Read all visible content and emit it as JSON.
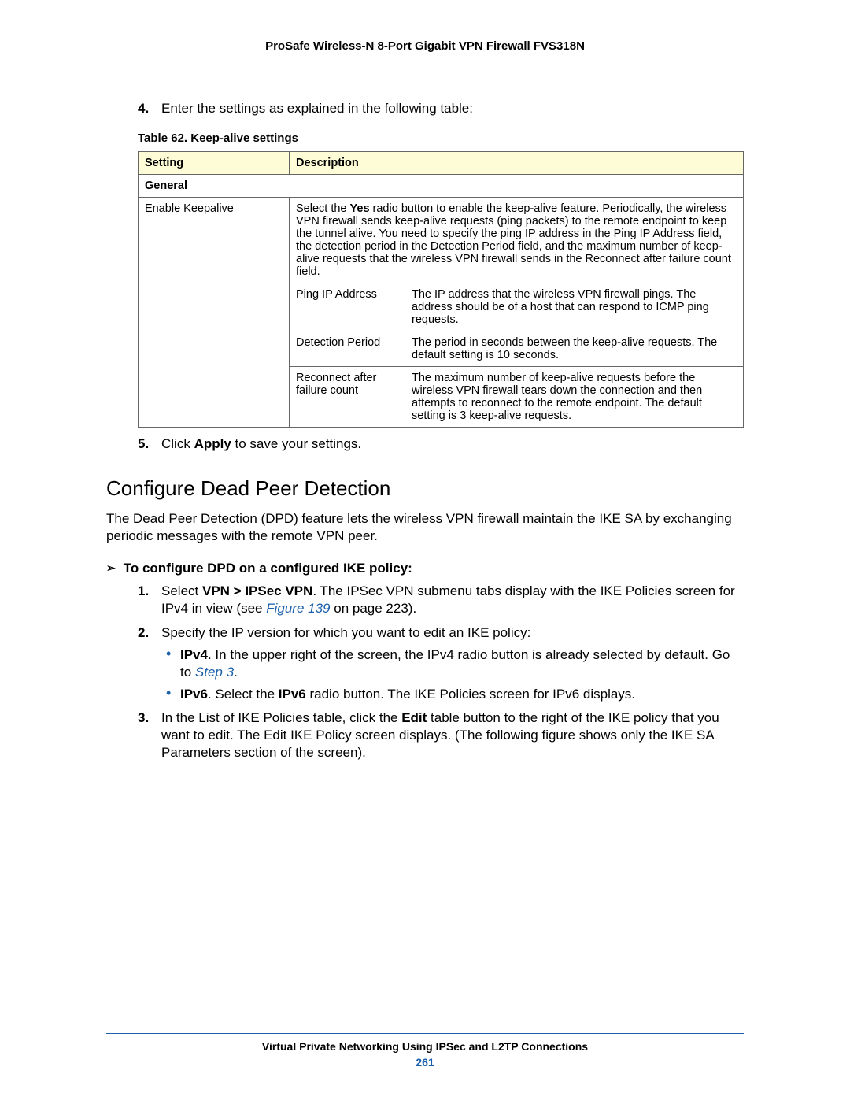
{
  "header": {
    "title": "ProSafe Wireless-N 8-Port Gigabit VPN Firewall FVS318N"
  },
  "step4": {
    "num": "4.",
    "text": "Enter the settings as explained in the following table:"
  },
  "table": {
    "caption": "Table 62.  Keep-alive settings",
    "col1": "Setting",
    "col2": "Description",
    "section": "General",
    "row1_setting": "Enable Keepalive",
    "row1_desc_a": "Select the ",
    "row1_desc_yes": "Yes",
    "row1_desc_b": " radio button to enable the keep-alive feature. Periodically, the wireless VPN firewall sends keep-alive requests (ping packets) to the remote endpoint to keep the tunnel alive. You need to specify the ping IP address in the Ping IP Address field, the detection period in the Detection Period field, and the maximum number of keep-alive requests that the wireless VPN firewall sends in the Reconnect after failure count field.",
    "sub1_label": "Ping IP Address",
    "sub1_desc": "The IP address that the wireless VPN firewall pings. The address should be of a host that can respond to ICMP ping requests.",
    "sub2_label": "Detection Period",
    "sub2_desc": "The period in seconds between the keep-alive requests. The default setting is 10 seconds.",
    "sub3_label": "Reconnect after failure count",
    "sub3_desc": "The maximum number of keep-alive requests before the wireless VPN firewall tears down the connection and then attempts to reconnect to the remote endpoint. The default setting is 3 keep-alive requests."
  },
  "step5": {
    "num": "5.",
    "a": "Click ",
    "apply": "Apply",
    "b": " to save your settings."
  },
  "heading": "Configure Dead Peer Detection",
  "intro": "The Dead Peer Detection (DPD) feature lets the wireless VPN firewall maintain the IKE SA by exchanging periodic messages with the remote VPN peer.",
  "proc": {
    "arrow": "➢",
    "title": "To configure DPD on a configured IKE policy:",
    "s1": {
      "num": "1.",
      "a": "Select ",
      "path": "VPN > IPSec VPN",
      "b": ". The IPSec VPN submenu tabs display with the IKE Policies screen for IPv4 in view (see ",
      "link": "Figure 139",
      "c": " on page 223)."
    },
    "s2": {
      "num": "2.",
      "text": "Specify the IP version for which you want to edit an IKE policy:",
      "b1a": "IPv4",
      "b1b": ". In the upper right of the screen, the IPv4 radio button is already selected by default. Go to ",
      "b1link": "Step 3",
      "b1c": ".",
      "b2a": "IPv6",
      "b2b": ". Select the ",
      "b2c": "IPv6",
      "b2d": " radio button. The IKE Policies screen for IPv6 displays."
    },
    "s3": {
      "num": "3.",
      "a": "In the List of IKE Policies table, click the ",
      "edit": "Edit",
      "b": " table button to the right of the IKE policy that you want to edit. The Edit IKE Policy screen displays. (The following figure shows only the IKE SA Parameters section of the screen)."
    }
  },
  "footer": {
    "title": "Virtual Private Networking Using IPSec and L2TP Connections",
    "page": "261"
  }
}
